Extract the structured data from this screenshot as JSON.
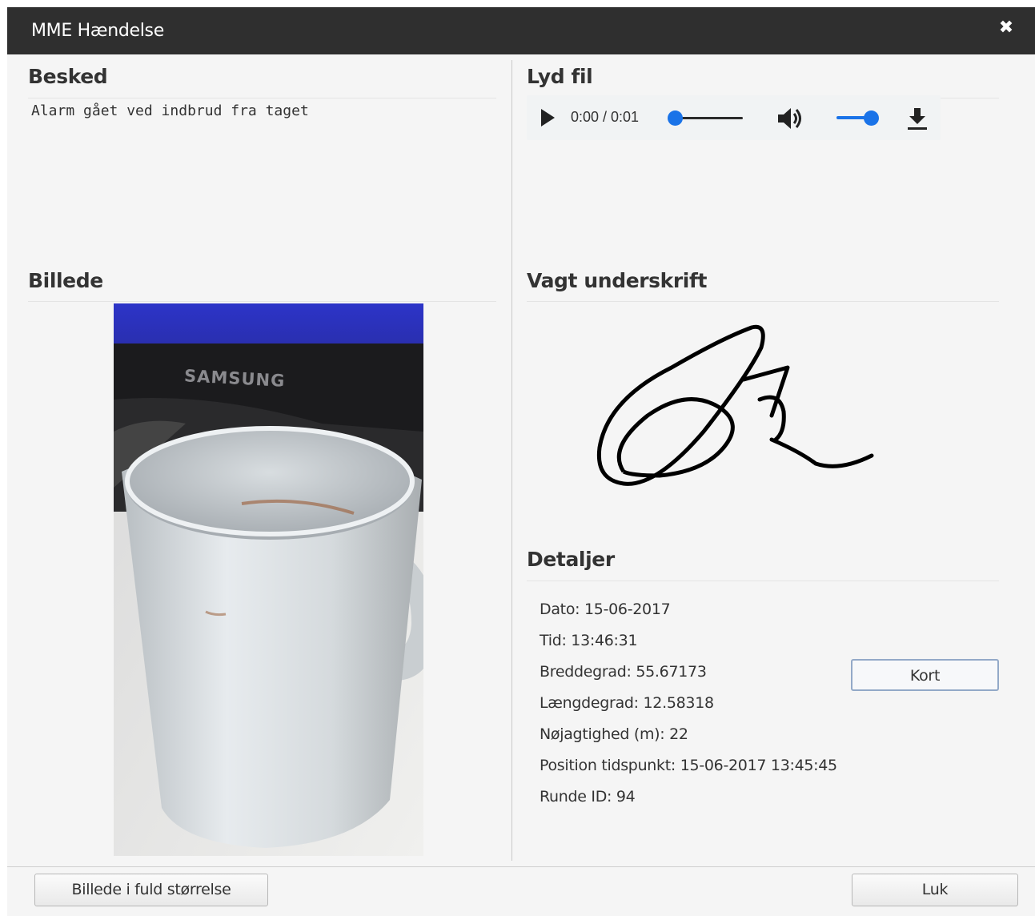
{
  "dialog": {
    "title": "MME Hændelse",
    "close_icon": "close-icon"
  },
  "besked": {
    "heading": "Besked",
    "text": "Alarm gået ved indbrud fra taget"
  },
  "lyd": {
    "heading": "Lyd fil",
    "time": "0:00 / 0:01",
    "progress": 0,
    "volume": 1,
    "icons": [
      "play-icon",
      "volume-icon",
      "download-icon"
    ],
    "accent": "#1a73e8"
  },
  "billede": {
    "heading": "Billede",
    "photo_label": "SAMSUNG"
  },
  "underskrift": {
    "heading": "Vagt underskrift"
  },
  "detaljer": {
    "heading": "Detaljer",
    "rows": [
      "Dato: 15-06-2017",
      "Tid: 13:46:31",
      "Breddegrad: 55.67173",
      "Længdegrad: 12.58318",
      "Nøjagtighed (m): 22",
      "Position tidspunkt: 15-06-2017 13:45:45",
      "Runde ID: 94"
    ],
    "map_button": "Kort"
  },
  "footer": {
    "full_image_button": "Billede i fuld størrelse",
    "close_button": "Luk"
  }
}
